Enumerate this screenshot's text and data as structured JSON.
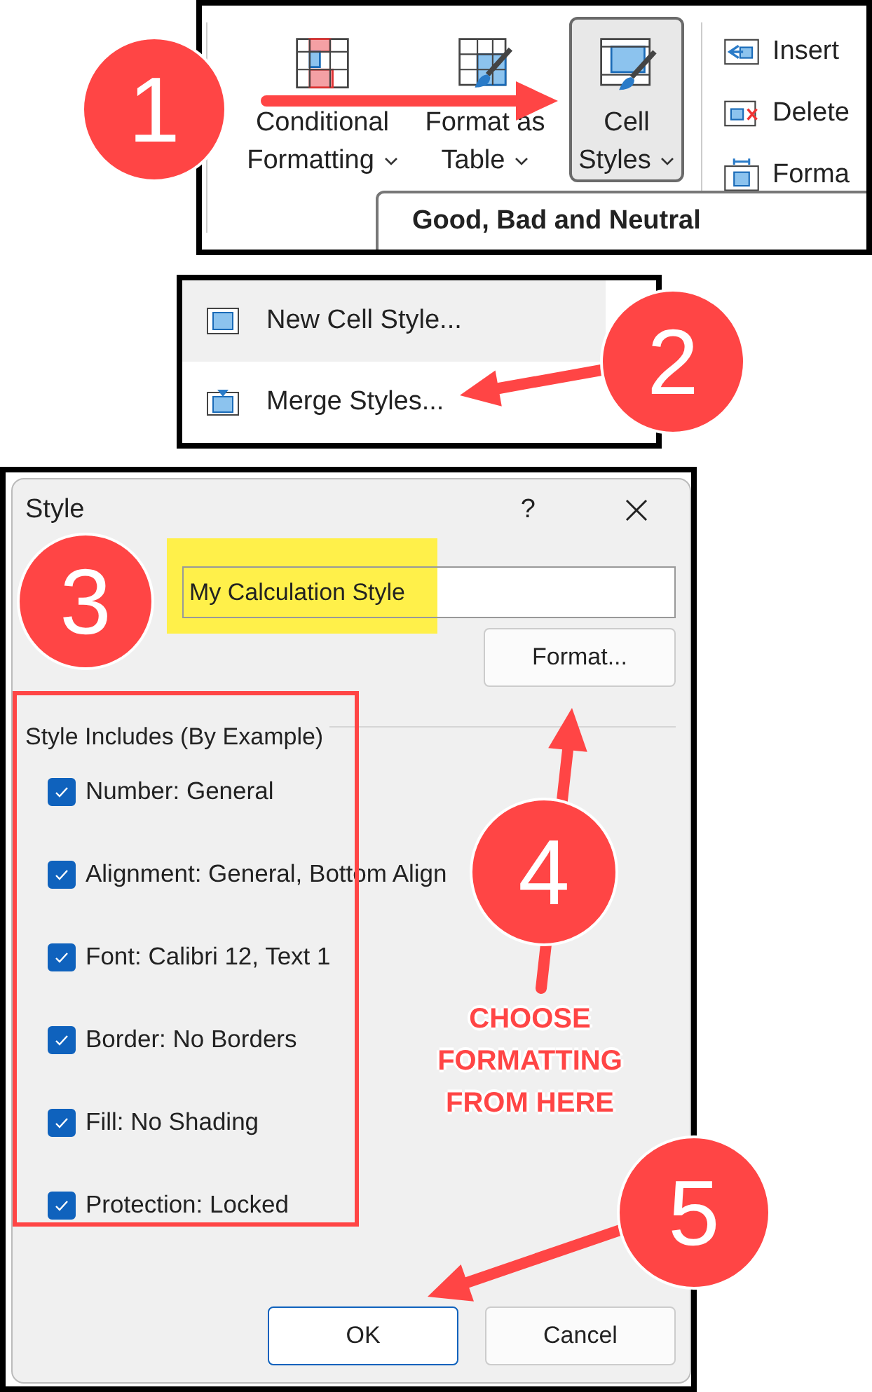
{
  "ribbon": {
    "buttons": [
      {
        "kind": "conditional-formatting",
        "line1": "Conditional",
        "line2": "Formatting",
        "selected": false
      },
      {
        "kind": "format-as-table",
        "line1": "Format as",
        "line2": "Table",
        "selected": false
      },
      {
        "kind": "cell-styles",
        "line1": "Cell",
        "line2": "Styles",
        "selected": true
      }
    ],
    "small_buttons": [
      {
        "kind": "insert",
        "label": "Insert"
      },
      {
        "kind": "delete",
        "label": "Delete"
      },
      {
        "kind": "format",
        "label": "Forma"
      }
    ],
    "dropdown": {
      "heading": "Good, Bad and Neutral"
    }
  },
  "menu": {
    "items": [
      {
        "kind": "new",
        "label": "New Cell Style...",
        "hovered": true
      },
      {
        "kind": "merge",
        "label": "Merge Styles...",
        "hovered": false
      }
    ]
  },
  "dialog": {
    "title": "Style",
    "help": "?",
    "name_value": "My Calculation Style",
    "format_button": "Format...",
    "group_title": "Style Includes (By Example)",
    "includes": [
      {
        "label": "Number: General",
        "checked": true
      },
      {
        "label": "Alignment: General, Bottom Align",
        "checked": true
      },
      {
        "label": "Font: Calibri 12, Text 1",
        "checked": true
      },
      {
        "label": "Border: No Borders",
        "checked": true
      },
      {
        "label": "Fill: No Shading",
        "checked": true
      },
      {
        "label": "Protection: Locked",
        "checked": true
      }
    ],
    "buttons": [
      {
        "label": "OK",
        "default": true
      },
      {
        "label": "Cancel",
        "default": false
      }
    ]
  },
  "annotations": {
    "steps": [
      {
        "number": "1"
      },
      {
        "number": "2"
      },
      {
        "number": "3"
      },
      {
        "number": "4"
      },
      {
        "number": "5"
      }
    ],
    "caption": "CHOOSE FORMATTING FROM HERE"
  }
}
